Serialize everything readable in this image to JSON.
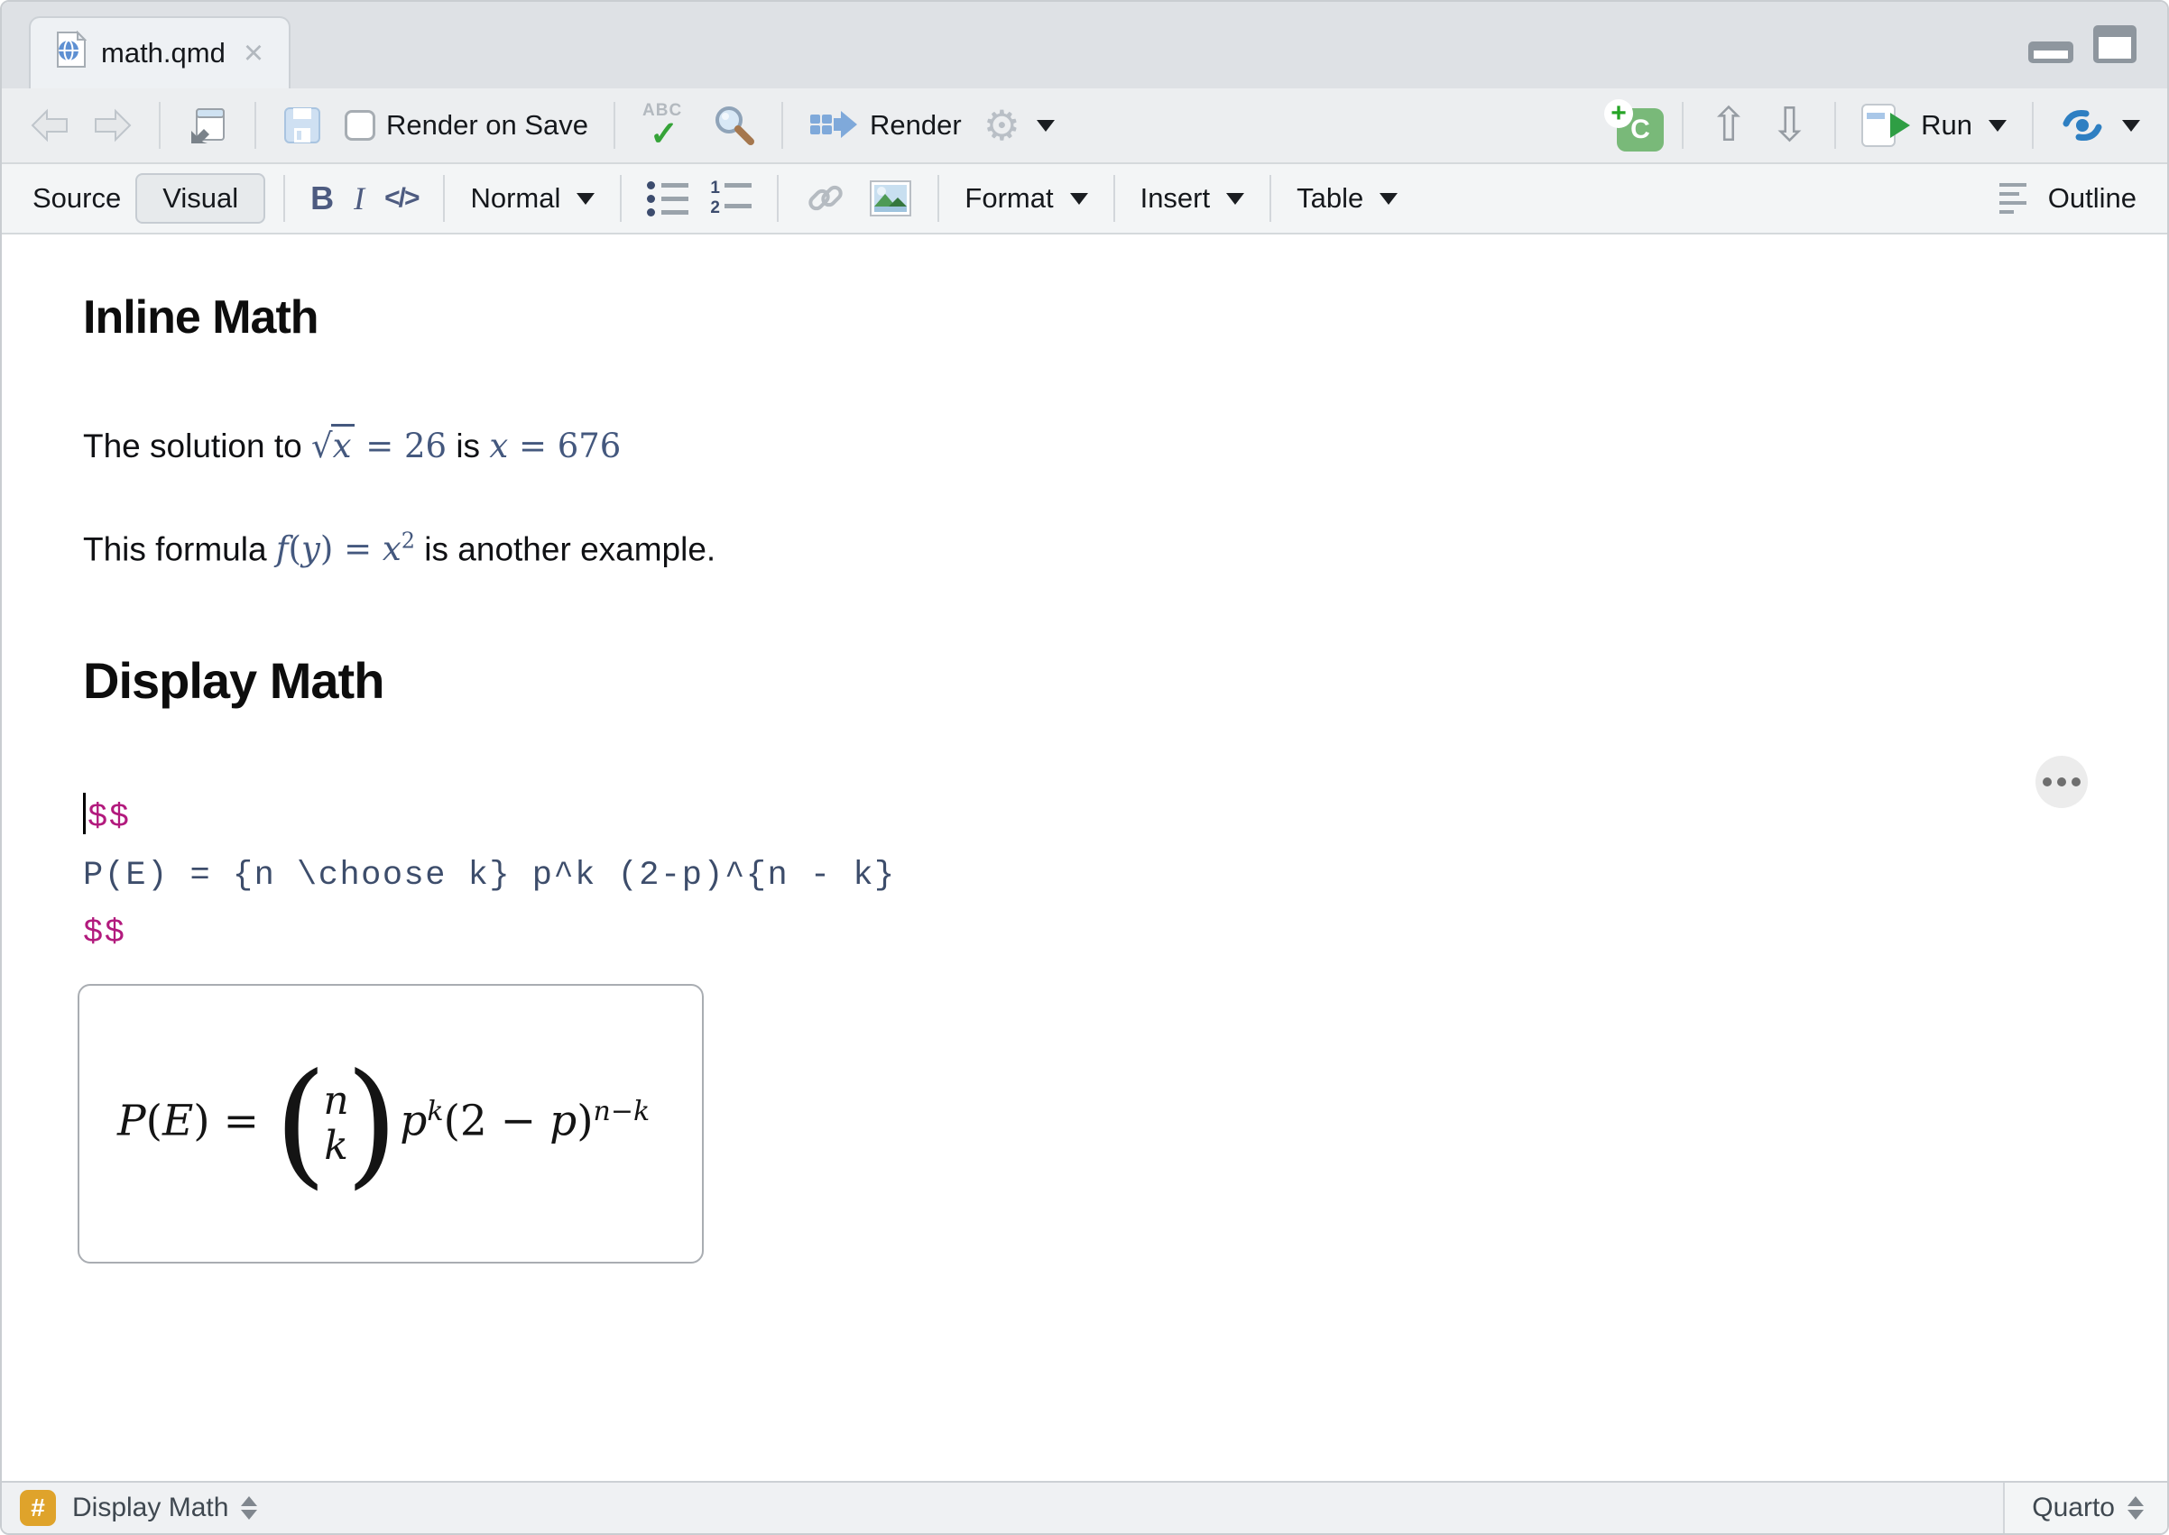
{
  "window": {
    "tab_title": "math.qmd"
  },
  "toolbar": {
    "render_on_save": "Render on Save",
    "spellcheck_abc": "ABC",
    "render": "Render",
    "run": "Run",
    "chunk_c": "C",
    "chunk_plus": "+"
  },
  "format_bar": {
    "source": "Source",
    "visual": "Visual",
    "bold": "B",
    "italic": "I",
    "code": "</>",
    "style": "Normal",
    "format": "Format",
    "insert": "Insert",
    "table": "Table",
    "outline": "Outline"
  },
  "icons": {
    "gear": "⚙",
    "close_tab": "×",
    "check": "✓",
    "up_arrow": "⇧",
    "down_arrow": "⇩",
    "num_one": "1",
    "num_two": "2"
  },
  "content": {
    "heading_inline": "Inline Math",
    "heading_display": "Display Math",
    "para1": {
      "before": "The solution to ",
      "sqrt": "√",
      "radicand": "x",
      "eq1": " = 26",
      "middle": " is ",
      "var2": "x",
      "eq2": " = 676"
    },
    "para2": {
      "before": "This formula ",
      "f": "f",
      "open": "(",
      "y": "y",
      "close": ") = ",
      "x": "x",
      "exponent": "2",
      "after": " is another example."
    },
    "code_block": {
      "open": "$$",
      "body": "P(E) = {n \\choose k} p^k (2-p)^{n - k}",
      "close": "$$"
    },
    "preview": {
      "P": "P",
      "lp": "(",
      "E": "E",
      "rp": ")",
      "equals": " = ",
      "paren_open": "(",
      "binom_top": "n",
      "binom_bottom": "k",
      "paren_close": ")",
      "p1": "p",
      "sup1": "k",
      "lp2": "(",
      "two": "2",
      "minus": " − ",
      "p2": "p",
      "rp2": ")",
      "sup2": "n−k"
    }
  },
  "status_bar": {
    "hash": "#",
    "section": "Display Math",
    "mode": "Quarto"
  },
  "colors": {
    "math_delim_magenta": "#b21a7d",
    "code_text_blue": "#3d4d6b",
    "inline_math_blue": "#44587e",
    "run_arrow_green": "#2f9e44",
    "chunk_icon_green": "#79b979",
    "section_hash_amber": "#dfa32b",
    "render_icon_blue": "#7fa9da",
    "rerun_icon_blue": "#2e7fc2"
  }
}
